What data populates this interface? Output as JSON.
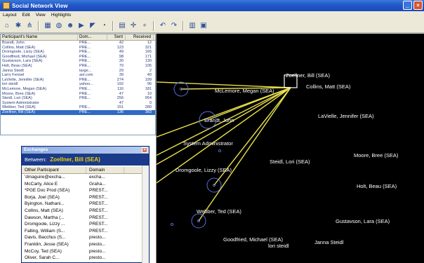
{
  "window": {
    "title": "Social Network View"
  },
  "menu": [
    "Layout",
    "Edit",
    "View",
    "Highlights"
  ],
  "toolbar": {
    "icons": [
      "layout-tree-icon",
      "layout-radial-icon",
      "layout-hierarchy-icon",
      "grid-icon",
      "filter-icon",
      "person-icon",
      "pointer-icon",
      "select-icon",
      "zoom-icon",
      "chart-icon",
      "move-icon",
      "add-node-icon",
      "undo-icon",
      "redo-icon",
      "table-view-icon",
      "panel-view-icon"
    ]
  },
  "participants": {
    "columns": [
      "Participant's Name",
      "Dom...",
      "Sent",
      "Received"
    ],
    "rows": [
      [
        "Brandt, John",
        "PRE...",
        "42",
        "12"
      ],
      [
        "Collins, Matt (SEA)",
        "PRE...",
        "123",
        "321"
      ],
      [
        "Dromgoole, Lizzy (SEA)",
        "PRE...",
        "49",
        "165"
      ],
      [
        "Goodfried, Michael (SEA)",
        "PRE...",
        "98",
        "171"
      ],
      [
        "Gustavson, Lara (SEA)",
        "PRE...",
        "30",
        "130"
      ],
      [
        "Holt, Beau (SEA)",
        "PRE...",
        "70",
        "105"
      ],
      [
        "Janna Steidl",
        "targe...",
        "29",
        "2"
      ],
      [
        "Larry Fennel",
        "aol.com",
        "39",
        "40"
      ],
      [
        "LaVielle, Jennifer (SEA)",
        "PRE...",
        "274",
        "199"
      ],
      [
        "lori steidl",
        "yahoo...",
        "192",
        "96"
      ],
      [
        "McLemore, Megan (SEA)",
        "PRE...",
        "116",
        "181"
      ],
      [
        "Moore, Bree (SEA)",
        "PRE...",
        "47",
        "10"
      ],
      [
        "Steidl, Lori (SEA)",
        "PRE...",
        "256",
        "954"
      ],
      [
        "System Administrator",
        "",
        "47",
        "0"
      ],
      [
        "Webber, Ted (SEA)",
        "PRE...",
        "151",
        "280"
      ],
      [
        "Zoellner, Bill (SEA)",
        "PRE...",
        "136",
        "383"
      ]
    ],
    "selected_index": 15
  },
  "exchanges": {
    "title": "Exchanges",
    "between_label": "Between:",
    "between_name": "Zoellner, Bill (SEA)",
    "columns": [
      "Other Participant",
      "Domain"
    ],
    "rows": [
      [
        "'dmaguire@excha...",
        "excha..."
      ],
      [
        "McCarty, Alice E",
        "Graha..."
      ],
      [
        "*PGE Doc Prod (SEA)",
        "PREST..."
      ],
      [
        "Borja, Joel (SEA)",
        "PREST..."
      ],
      [
        "Byington, Nathani...",
        "PREST..."
      ],
      [
        "Collins, Matt (SEA)",
        "PREST..."
      ],
      [
        "Dawson, Martha (...",
        "PREST..."
      ],
      [
        "Dromgoole, Lizzy ...",
        "PREST..."
      ],
      [
        "Falling, William (S...",
        "PREST..."
      ],
      [
        "Davis, Bacchus (S...",
        "presto..."
      ],
      [
        "Franklin, Jesse (SEA)",
        "presto..."
      ],
      [
        "McCoy, Ted (SEA)",
        "presto..."
      ],
      [
        "Oliver, Sarah C...",
        "presto..."
      ]
    ]
  },
  "network": {
    "center": "Zoellner, Bill (SEA)",
    "nodes": [
      "Zoellner, Bill (SEA)",
      "McLemore, Megan (SEA)",
      "Collins, Matt (SEA)",
      "Brandt, John",
      "LaVielle, Jennifer (SEA)",
      "System Administrator",
      "Moore, Bree (SEA)",
      "Steidl, Lori (SEA)",
      "Dromgoole, Lizzy (SEA)",
      "Holt, Beau (SEA)",
      "Webber, Ted (SEA)",
      "Gustavson, Lara (SEA)",
      "Goodfried, Michael (SEA)",
      "lori steidl",
      "Janna Steidl"
    ],
    "colors": {
      "background": "#000000",
      "label": "#ffffff",
      "edge": "#e8e04a",
      "ring": "#5a6fd8"
    }
  }
}
